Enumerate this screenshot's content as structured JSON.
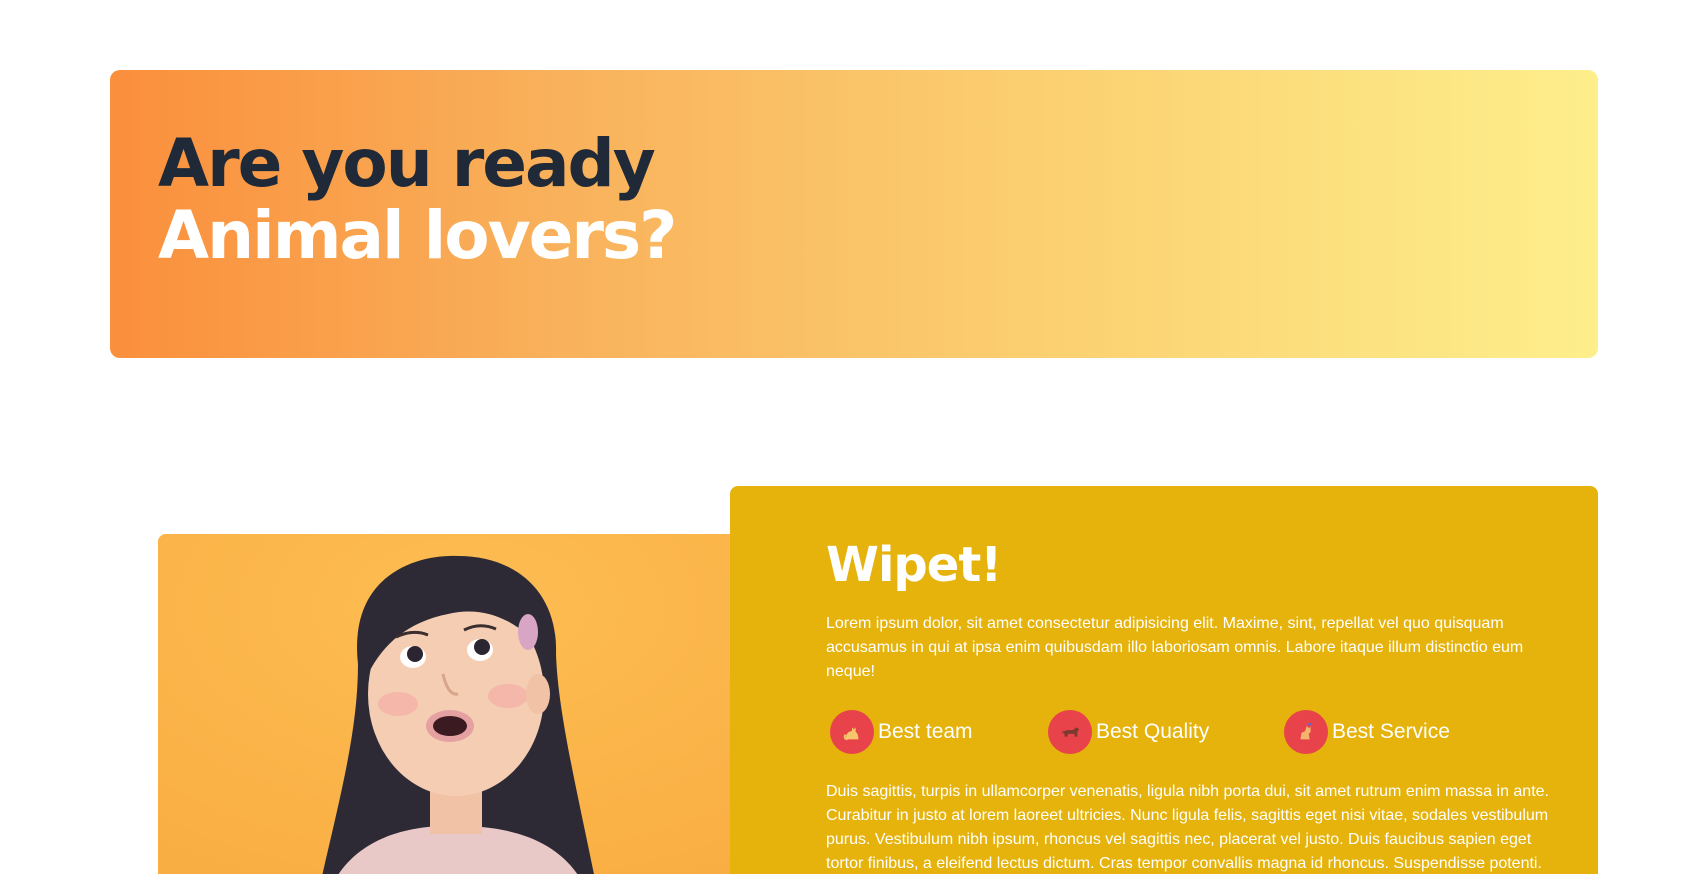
{
  "hero": {
    "line1": "Are you ready",
    "line2": "Animal lovers?"
  },
  "about": {
    "title": "Wipet!",
    "intro": "Lorem ipsum dolor, sit amet consectetur adipisicing elit. Maxime, sint, repellat vel quo quisquam accusamus in qui at ipsa enim quibusdam illo laboriosam omnis. Labore itaque illum distinctio eum neque!",
    "features": [
      {
        "icon": "cat-icon",
        "label": "Best team"
      },
      {
        "icon": "dog-icon",
        "label": "Best Quality"
      },
      {
        "icon": "pet-icon",
        "label": "Best Service"
      }
    ],
    "body": "Duis sagittis, turpis in ullamcorper venenatis, ligula nibh porta dui, sit amet rutrum enim massa in ante. Curabitur in justo at lorem laoreet ultricies. Nunc ligula felis, sagittis eget nisi vitae, sodales vestibulum purus. Vestibulum nibh ipsum, rhoncus vel sagittis nec, placerat vel justo. Duis faucibus sapien eget tortor finibus, a eleifend lectus dictum. Cras tempor convallis magna id rhoncus. Suspendisse potenti. Nam"
  },
  "colors": {
    "hero_gradient_start": "#fa8f3c",
    "hero_gradient_end": "#fdef8b",
    "card_background": "#e6b30c",
    "feature_circle": "#e8424a",
    "heading_dark": "#1f2937",
    "photo_background": "#fbb54c"
  }
}
